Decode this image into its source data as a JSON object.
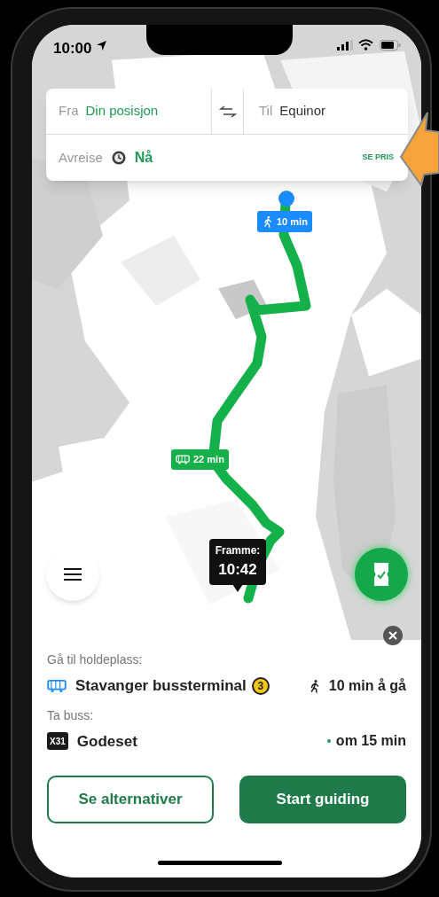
{
  "status_bar": {
    "time": "10:00"
  },
  "search": {
    "from_label": "Fra",
    "from_value": "Din posisjon",
    "to_label": "Til",
    "to_value": "Equinor",
    "departure_label": "Avreise",
    "departure_value": "Nå",
    "price_link": "SE PRIS"
  },
  "map": {
    "walk_badge": "10 min",
    "bus_badge": "22 min",
    "arrival": {
      "label": "Framme:",
      "time": "10:42"
    }
  },
  "trip": {
    "walk_heading": "Gå til holdeplass:",
    "stop_name": "Stavanger bussterminal",
    "platform": "3",
    "walk_time": "10 min å gå",
    "bus_heading": "Ta buss:",
    "line": "X31",
    "destination": "Godeset",
    "departure": "om 15 min"
  },
  "buttons": [
    {
      "label": "Se alternativer",
      "kind": "secondary"
    },
    {
      "label": "Start guiding",
      "kind": "primary"
    }
  ]
}
